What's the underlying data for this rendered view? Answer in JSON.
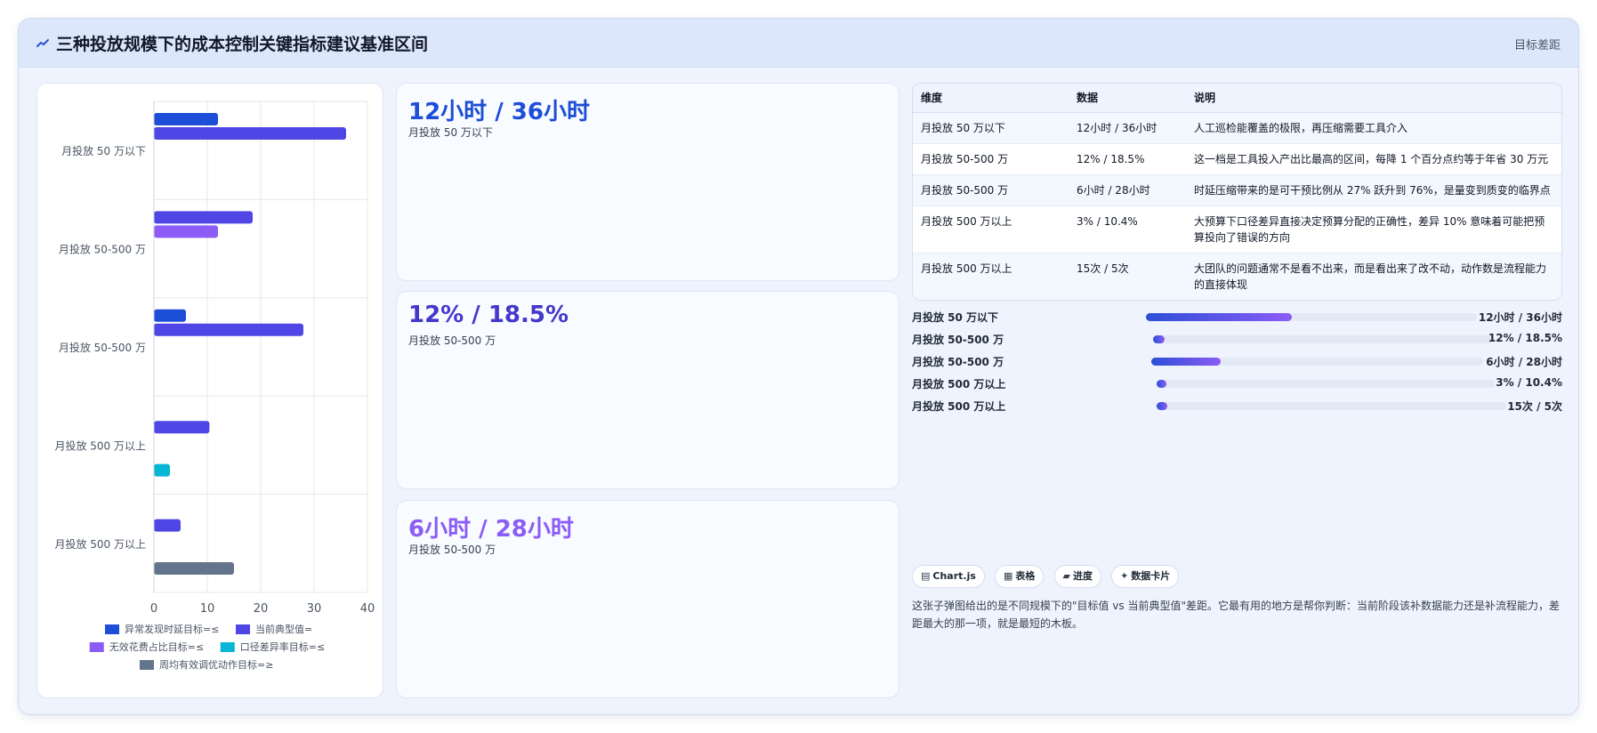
{
  "header": {
    "title": "三种投放规模下的成本控制关键指标建议基准区间",
    "right_label": "目标差距",
    "icon": "trend-icon"
  },
  "chart_data": {
    "type": "bar",
    "orientation": "horizontal",
    "categories": [
      "月投放 50 万以下",
      "月投放 50-500 万",
      "月投放 50-500 万",
      "月投放 500 万以上",
      "月投放 500 万以上"
    ],
    "series": [
      {
        "name": "异常发现时延目标=≤",
        "color": "#1d4ed8",
        "values": [
          12,
          null,
          6,
          null,
          null
        ]
      },
      {
        "name": "当前典型值=",
        "color": "#4f46e5",
        "values": [
          36,
          18.5,
          28,
          10.4,
          5
        ]
      },
      {
        "name": "无效花费占比目标=≤",
        "color": "#8b5cf6",
        "values": [
          null,
          12,
          null,
          null,
          null
        ]
      },
      {
        "name": "口径差异率目标=≤",
        "color": "#06b6d4",
        "values": [
          null,
          null,
          null,
          3,
          null
        ]
      },
      {
        "name": "周均有效调优动作目标=≥",
        "color": "#64748b",
        "values": [
          null,
          null,
          null,
          null,
          15
        ]
      }
    ],
    "xlim": [
      0,
      40
    ],
    "xticks": [
      0,
      10,
      20,
      30,
      40
    ],
    "grid": true,
    "legend_position": "bottom"
  },
  "stats": [
    {
      "value": "12小时 / 36小时",
      "sub": "月投放 50 万以下",
      "color": "#1d4ed8"
    },
    {
      "value": "12% / 18.5%",
      "sub": "月投放 50-500 万",
      "color": "#4338ca"
    },
    {
      "value": "6小时 / 28小时",
      "sub": "月投放 50-500 万",
      "color": "#8b5cf6"
    }
  ],
  "table": {
    "headers": [
      "维度",
      "数据",
      "说明"
    ],
    "rows": [
      {
        "dim": "月投放 50 万以下",
        "data": "12小时 / 36小时",
        "desc": "人工巡检能覆盖的极限，再压缩需要工具介入"
      },
      {
        "dim": "月投放 50-500 万",
        "data": "12% / 18.5%",
        "desc": "这一档是工具投入产出比最高的区间，每降 1 个百分点约等于年省 30 万元"
      },
      {
        "dim": "月投放 50-500 万",
        "data": "6小时 / 28小时",
        "desc": "时延压缩带来的是可干预比例从 27% 跃升到 76%，是量变到质变的临界点"
      },
      {
        "dim": "月投放 500 万以上",
        "data": "3% / 10.4%",
        "desc": "大预算下口径差异直接决定预算分配的正确性，差异 10% 意味着可能把预算投向了错误的方向"
      },
      {
        "dim": "月投放 500 万以上",
        "data": "15次 / 5次",
        "desc": "大团队的问题通常不是看不出来，而是看出来了改不动，动作数是流程能力的直接体现"
      }
    ]
  },
  "progress": [
    {
      "label": "月投放 50 万以下",
      "value": "12小时 / 36小时",
      "fraction": 0.44
    },
    {
      "label": "月投放 50-500 万",
      "value": "12% / 18.5%",
      "fraction": 0.035
    },
    {
      "label": "月投放 50-500 万",
      "value": "6小时 / 28小时",
      "fraction": 0.21
    },
    {
      "label": "月投放 500 万以上",
      "value": "3% / 10.4%",
      "fraction": 0.03
    },
    {
      "label": "月投放 500 万以上",
      "value": "15次 / 5次",
      "fraction": 0.03
    }
  ],
  "pills": [
    {
      "icon": "chart-icon",
      "glyph": "▤",
      "label": "Chart.js"
    },
    {
      "icon": "table-icon",
      "glyph": "▦",
      "label": "表格"
    },
    {
      "icon": "progress-icon",
      "glyph": "▰",
      "label": "进度"
    },
    {
      "icon": "card-icon",
      "glyph": "✦",
      "label": "数据卡片"
    }
  ],
  "note": "这张子弹图给出的是不同规模下的\"目标值 vs 当前典型值\"差距。它最有用的地方是帮你判断：当前阶段该补数据能力还是补流程能力，差距最大的那一项，就是最短的木板。"
}
